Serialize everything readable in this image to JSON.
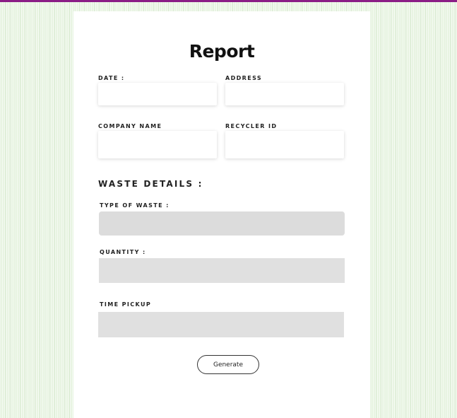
{
  "page": {
    "title": "Report",
    "accent_color": "#8b1d86",
    "background_color": "#e8f4e2"
  },
  "fields": {
    "date": {
      "label": "DATE :",
      "value": ""
    },
    "address": {
      "label": "ADDRESS",
      "value": ""
    },
    "company_name": {
      "label": "COMPANY NAME",
      "value": ""
    },
    "recycler_id": {
      "label": "RECYCLER ID",
      "value": ""
    }
  },
  "waste_details": {
    "heading": "WASTE DETAILS :",
    "type_of_waste": {
      "label": "TYPE OF WASTE :",
      "value": "",
      "bg_color": "#dcdcdc"
    },
    "quantity": {
      "label": "QUANTITY :",
      "value": "",
      "bg_color": "#e0e0e0"
    },
    "time_pickup": {
      "label": "TIME PICKUP",
      "value": "",
      "bg_color": "#e0e0e0"
    }
  },
  "actions": {
    "generate_label": "Generate"
  }
}
